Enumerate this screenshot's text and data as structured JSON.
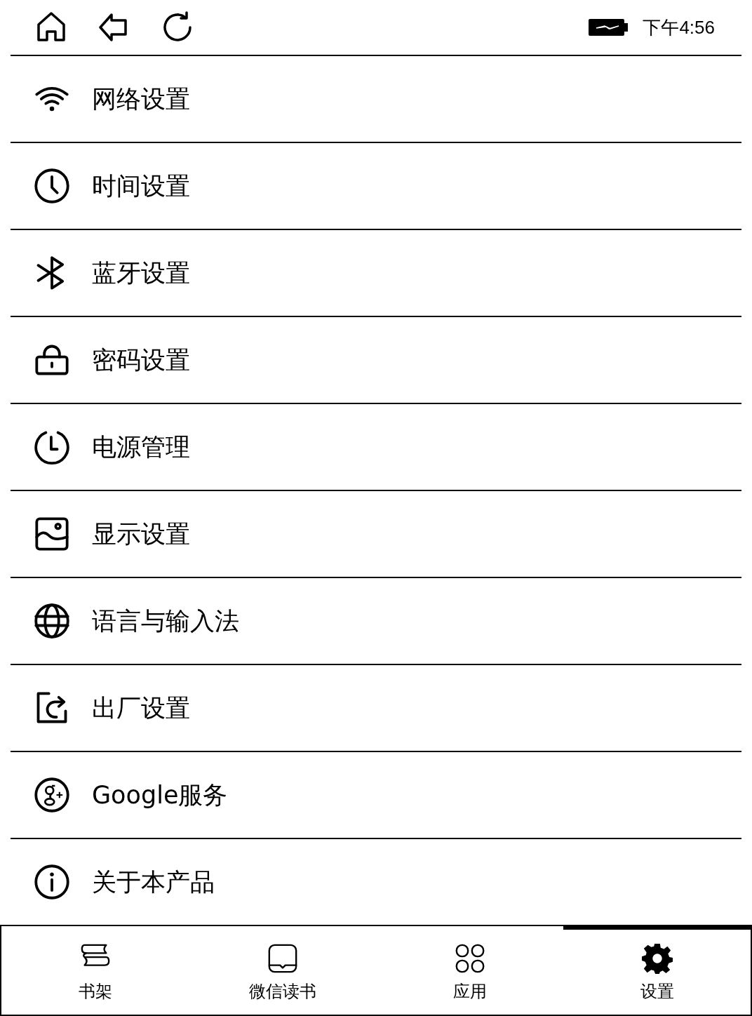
{
  "status_bar": {
    "time": "下午4:56"
  },
  "menu": [
    {
      "label": "网络设置"
    },
    {
      "label": "时间设置"
    },
    {
      "label": "蓝牙设置"
    },
    {
      "label": "密码设置"
    },
    {
      "label": "电源管理"
    },
    {
      "label": "显示设置"
    },
    {
      "label": "语言与输入法"
    },
    {
      "label": "出厂设置"
    },
    {
      "label": "Google服务"
    },
    {
      "label": "关于本产品"
    }
  ],
  "tabs": [
    {
      "label": "书架",
      "selected": false
    },
    {
      "label": "微信读书",
      "selected": false
    },
    {
      "label": "应用",
      "selected": false
    },
    {
      "label": "设置",
      "selected": true
    }
  ]
}
